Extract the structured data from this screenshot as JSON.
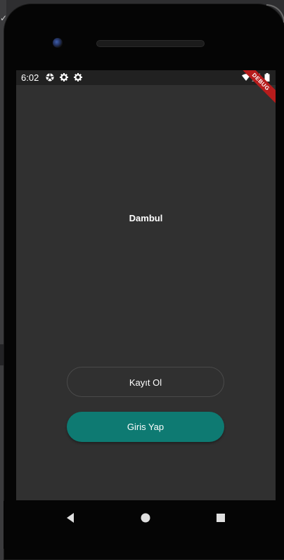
{
  "status_bar": {
    "time": "6:02",
    "left_icons": [
      "android-ball-icon",
      "gear-icon",
      "gear-icon"
    ],
    "right_icons": [
      "wifi-icon",
      "signal-icon",
      "battery-icon"
    ],
    "debug_banner": "DEBUG",
    "debug_color": "#b71c1c"
  },
  "app": {
    "title": "Dambul",
    "register_button_label": "Kayıt Ol",
    "login_button_label": "Giris Yap",
    "accent_color": "#0e7a72",
    "background_color": "#303030"
  },
  "navigation_bar": {
    "back_icon": "back-triangle-icon",
    "home_icon": "home-circle-icon",
    "recents_icon": "recents-square-icon"
  }
}
